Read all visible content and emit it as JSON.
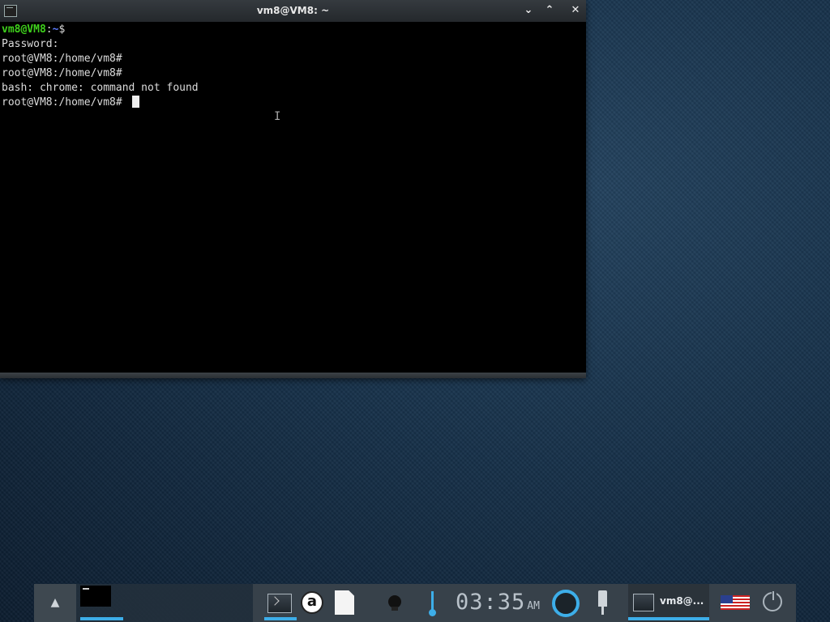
{
  "window": {
    "title": "vm8@VM8: ~",
    "controls": {
      "minimize": "⌄",
      "maximize": "⌃",
      "close": "✕"
    }
  },
  "terminal": {
    "prompt_user": "vm8@VM8",
    "prompt_sep": ":",
    "prompt_path": "~",
    "prompt_symbol": "$",
    "lines": [
      "Password:",
      "root@VM8:/home/vm8#",
      "root@VM8:/home/vm8#",
      "bash: chrome: command not found",
      "root@VM8:/home/vm8# "
    ]
  },
  "taskbar": {
    "show_desktop_icon": "chevron-up-icon",
    "show_desktop_glyph": "▲",
    "launcher_a_label": "a",
    "clock": {
      "time": "03:35",
      "ampm": "AM"
    },
    "task_entry_label": "vm8@...",
    "keyboard_layout": "us-flag-icon",
    "accent_color": "#3daee9"
  }
}
